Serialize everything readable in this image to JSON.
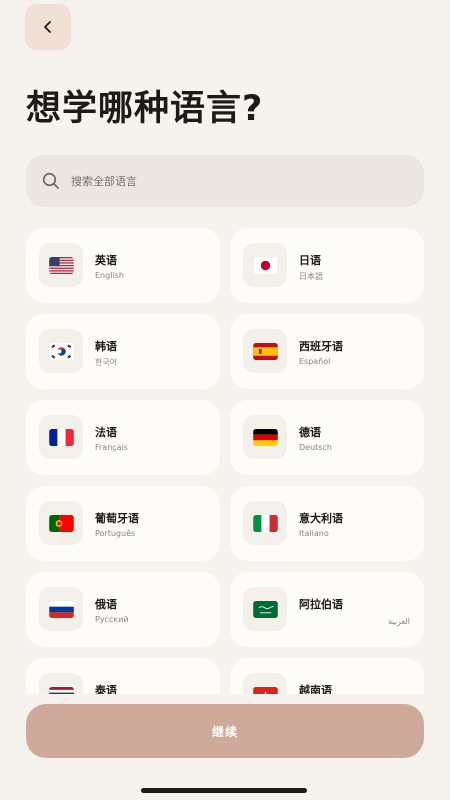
{
  "header": {
    "back_icon": "chevron-left-icon",
    "title": "想学哪种语言?"
  },
  "search": {
    "placeholder": "搜索全部语言",
    "value": "",
    "icon": "search-icon"
  },
  "languages": [
    {
      "name": "英语",
      "native": "English",
      "flag": "us"
    },
    {
      "name": "日语",
      "native": "日本語",
      "flag": "jp"
    },
    {
      "name": "韩语",
      "native": "한국어",
      "flag": "kr"
    },
    {
      "name": "西班牙语",
      "native": "Español",
      "flag": "es"
    },
    {
      "name": "法语",
      "native": "Français",
      "flag": "fr"
    },
    {
      "name": "德语",
      "native": "Deutsch",
      "flag": "de"
    },
    {
      "name": "葡萄牙语",
      "native": "Português",
      "flag": "pt"
    },
    {
      "name": "意大利语",
      "native": "Italiano",
      "flag": "it"
    },
    {
      "name": "俄语",
      "native": "Русский",
      "flag": "ru"
    },
    {
      "name": "阿拉伯语",
      "native": "العربية",
      "flag": "sa"
    },
    {
      "name": "泰语",
      "native": "",
      "flag": "th"
    },
    {
      "name": "越南语",
      "native": "",
      "flag": "vn"
    }
  ],
  "footer": {
    "continue_label": "继续"
  },
  "colors": {
    "background": "#f6f3ee",
    "card": "#fdfcf8",
    "accent": "#cfaa9a",
    "back_button": "#efdfd7"
  }
}
